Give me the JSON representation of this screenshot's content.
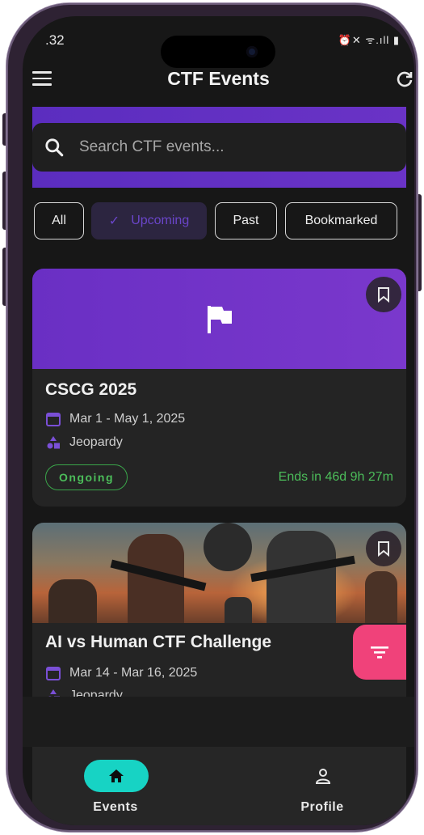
{
  "status_bar": {
    "time": ".32",
    "icons": "⏰✕ ᯤ.ıll ▮"
  },
  "app_bar": {
    "title": "CTF Events"
  },
  "search": {
    "placeholder": "Search CTF events..."
  },
  "filters": [
    {
      "label": "All",
      "selected": false
    },
    {
      "label": "Upcoming",
      "selected": true
    },
    {
      "label": "Past",
      "selected": false
    },
    {
      "label": "Bookmarked",
      "selected": false
    }
  ],
  "events": [
    {
      "title": "CSCG 2025",
      "date": "Mar 1 - May 1, 2025",
      "format": "Jeopardy",
      "status": "Ongoing",
      "ends": "Ends in 46d 9h 27m",
      "banner_icon": "flag-icon",
      "banner_color": "#6a2fc4"
    },
    {
      "title": "AI vs Human CTF Challenge",
      "date": "Mar 14 - Mar 16, 2025",
      "format": "Jeopardy",
      "banner_icon": "illustration"
    }
  ],
  "fab": {
    "icon": "filter-icon",
    "color": "#f0427a"
  },
  "bottom_nav": [
    {
      "label": "Events",
      "icon": "home-icon",
      "active": true
    },
    {
      "label": "Profile",
      "icon": "person-icon",
      "active": false
    }
  ],
  "colors": {
    "accent": "#6a2fc4",
    "nav_active": "#17d3c4",
    "success": "#4cbd5a",
    "background": "#171717"
  }
}
